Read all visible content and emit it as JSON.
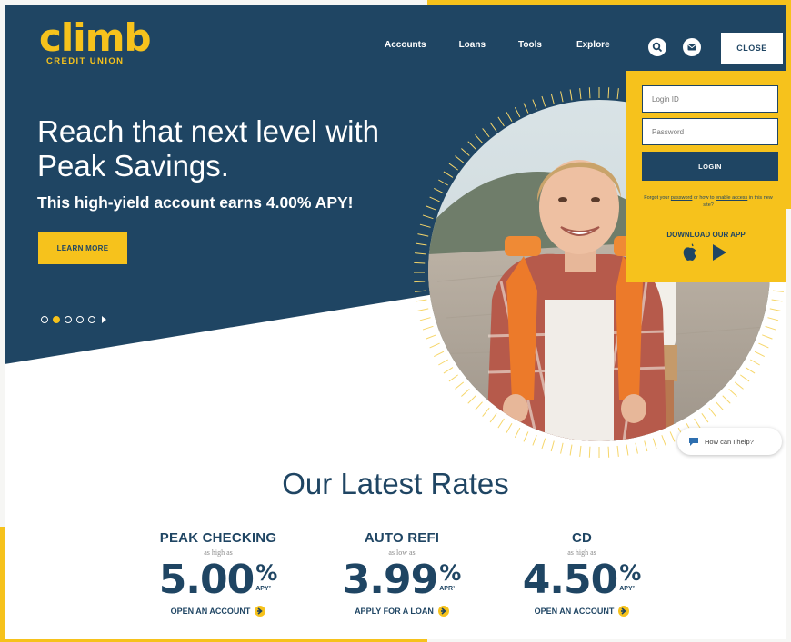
{
  "brand": {
    "name": "climb",
    "tagline": "CREDIT UNION",
    "navy": "#1f4563",
    "yellow": "#f6c21c"
  },
  "nav": {
    "items": [
      "Accounts",
      "Loans",
      "Tools",
      "Explore"
    ],
    "search_icon": "search-icon",
    "message_icon": "message-icon",
    "close_label": "CLOSE"
  },
  "hero": {
    "headline": "Reach that next level with Peak Savings.",
    "subheadline": "This high-yield account earns 4.00% APY!",
    "cta_label": "LEARN MORE",
    "slides_total": 5,
    "active_slide": 2
  },
  "login": {
    "login_id_placeholder": "Login ID",
    "password_placeholder": "Password",
    "login_button": "LOGIN",
    "forgot_prefix": "Forgot your",
    "forgot_password": "password",
    "forgot_middle": "or how to",
    "forgot_enable": "enable access",
    "forgot_suffix": "in this new site?",
    "forgot_line2_prefix": "",
    "download_label": "DOWNLOAD OUR APP"
  },
  "chat": {
    "label": "How can I help?"
  },
  "rates": {
    "title": "Our Latest Rates",
    "cards": [
      {
        "name": "PEAK CHECKING",
        "qualifier": "as high as",
        "value": "5.00",
        "percent": "%",
        "unit": "APY²",
        "link": "OPEN AN ACCOUNT"
      },
      {
        "name": "AUTO REFI",
        "qualifier": "as low as",
        "value": "3.99",
        "percent": "%",
        "unit": "APR¹",
        "link": "APPLY FOR A LOAN"
      },
      {
        "name": "CD",
        "qualifier": "as high as",
        "value": "4.50",
        "percent": "%",
        "unit": "APY²",
        "link": "OPEN AN ACCOUNT"
      }
    ]
  }
}
